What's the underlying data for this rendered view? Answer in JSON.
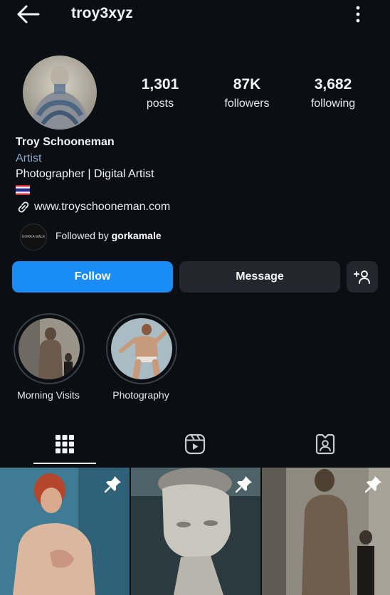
{
  "header": {
    "username": "troy3xyz"
  },
  "profile": {
    "stats": [
      {
        "value": "1,301",
        "label": "posts"
      },
      {
        "value": "87K",
        "label": "followers"
      },
      {
        "value": "3,682",
        "label": "following"
      }
    ],
    "name": "Troy Schooneman",
    "category": "Artist",
    "bio": "Photographer | Digital Artist",
    "website": "www.troyschooneman.com",
    "followed_by_prefix": "Followed by ",
    "followed_by_user": "gorkamale",
    "follower_avatar_text": "GORKA MALE"
  },
  "actions": {
    "follow_label": "Follow",
    "message_label": "Message",
    "add_user_icon": "add-person-icon"
  },
  "highlights": [
    {
      "label": "Morning Visits"
    },
    {
      "label": "Photography"
    }
  ],
  "tabs": [
    {
      "icon": "grid-icon",
      "active": true
    },
    {
      "icon": "reels-icon",
      "active": false
    },
    {
      "icon": "tagged-icon",
      "active": false
    }
  ],
  "colors": {
    "background": "#0b0f14",
    "accent": "#1a8cf5",
    "secondary_button": "#23262d",
    "category_text": "#8aa4c6"
  }
}
